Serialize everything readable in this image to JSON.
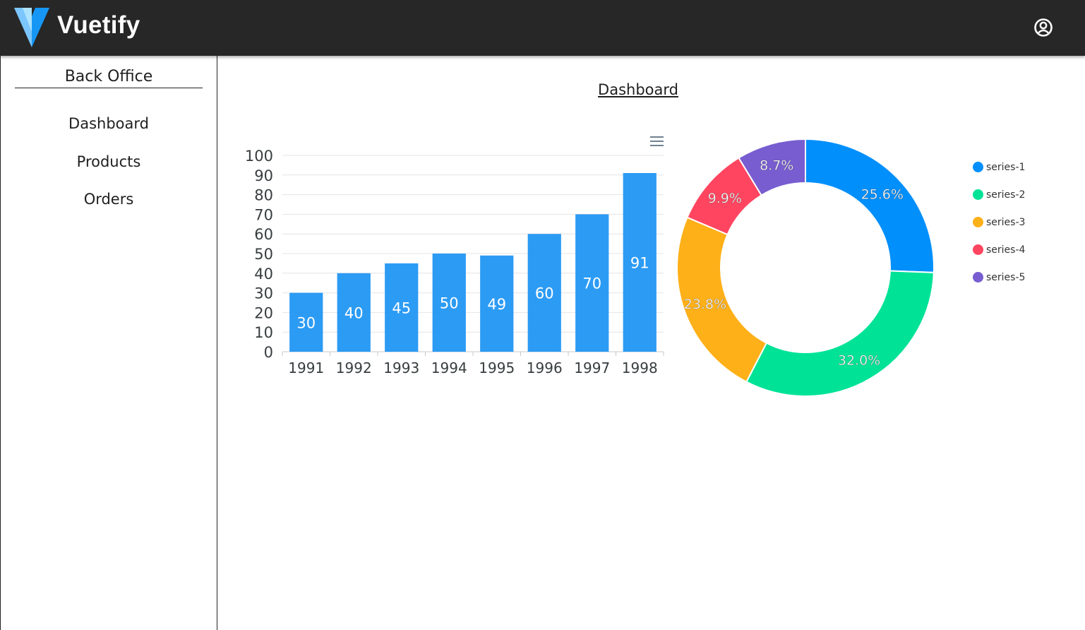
{
  "app": {
    "brand": "Vuetify"
  },
  "header": {
    "account_icon": "account-circle-icon"
  },
  "sidebar": {
    "title": "Back Office",
    "items": [
      {
        "label": "Dashboard"
      },
      {
        "label": "Products"
      },
      {
        "label": "Orders"
      }
    ]
  },
  "main": {
    "title": "Dashboard"
  },
  "colors": {
    "appbar": "#272727",
    "bar": "#2196f3",
    "series": [
      "#008ffb",
      "#00e396",
      "#feb019",
      "#ff4560",
      "#775dd0"
    ]
  },
  "chart_data": [
    {
      "type": "bar",
      "categories": [
        "1991",
        "1992",
        "1993",
        "1994",
        "1995",
        "1996",
        "1997",
        "1998"
      ],
      "values": [
        30,
        40,
        45,
        50,
        49,
        60,
        70,
        91
      ],
      "ylim": [
        0,
        100
      ],
      "yticks": [
        "0",
        "10",
        "20",
        "30",
        "40",
        "50",
        "60",
        "70",
        "80",
        "90",
        "100"
      ],
      "data_labels": true,
      "grid": true,
      "menu_icon": "hamburger-menu-icon"
    },
    {
      "type": "pie",
      "style": "donut",
      "series": [
        {
          "name": "series-1",
          "value": 25.6,
          "label": "25.6%"
        },
        {
          "name": "series-2",
          "value": 32.0,
          "label": "32.0%"
        },
        {
          "name": "series-3",
          "value": 23.8,
          "label": "23.8%"
        },
        {
          "name": "series-4",
          "value": 9.9,
          "label": "9.9%"
        },
        {
          "name": "series-5",
          "value": 8.7,
          "label": "8.7%"
        }
      ],
      "legend": "right"
    }
  ]
}
